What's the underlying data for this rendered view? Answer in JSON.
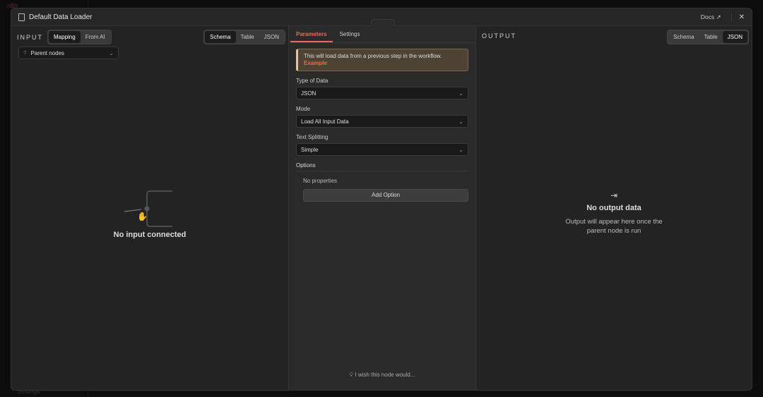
{
  "app": {
    "brand": "n8n",
    "settings": "Settings"
  },
  "modal": {
    "title": "Default Data Loader",
    "docs": "Docs"
  },
  "input": {
    "label": "INPUT",
    "modes": [
      "Mapping",
      "From AI"
    ],
    "views": [
      "Schema",
      "Table",
      "JSON"
    ],
    "parent_nodes": "Parent nodes",
    "empty": "No input connected"
  },
  "params": {
    "tabs": [
      "Parameters",
      "Settings"
    ],
    "notice": "This will load data from a previous step in the workflow.",
    "notice_link": "Example",
    "fields": [
      {
        "label": "Type of Data",
        "value": "JSON"
      },
      {
        "label": "Mode",
        "value": "Load All Input Data"
      },
      {
        "label": "Text Splitting",
        "value": "Simple"
      }
    ],
    "options_label": "Options",
    "no_props": "No properties",
    "add_option": "Add Option",
    "wish": "I wish this node would..."
  },
  "output": {
    "label": "OUTPUT",
    "views": [
      "Schema",
      "Table",
      "JSON"
    ],
    "empty_title": "No output data",
    "empty_text": "Output will appear here once the parent node is run"
  },
  "colors": {
    "accent": "#ea6b5c",
    "notice_bg": "#4d4233",
    "notice_border": "#e6c98a"
  }
}
